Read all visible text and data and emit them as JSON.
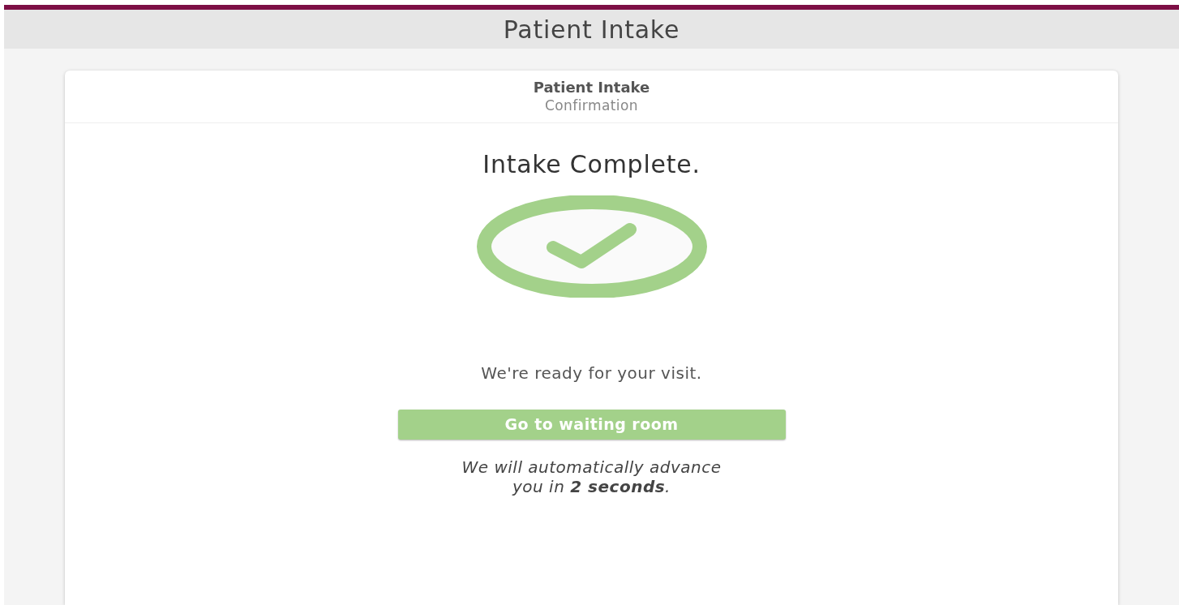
{
  "header": {
    "title": "Patient Intake"
  },
  "card": {
    "title": "Patient Intake",
    "subtitle": "Confirmation",
    "heading": "Intake Complete.",
    "message": "We're ready for your visit.",
    "button": "Go to waiting room",
    "note": "We will automatically advance\nyou in **2 seconds**."
  }
}
